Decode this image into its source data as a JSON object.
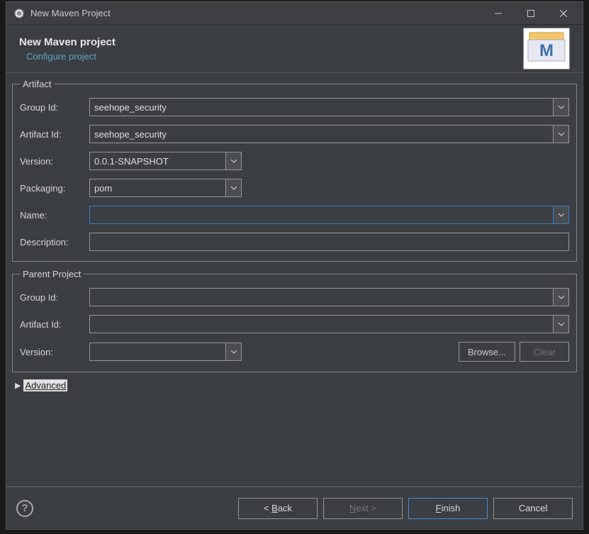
{
  "titlebar": {
    "title": "New Maven Project"
  },
  "banner": {
    "title": "New Maven project",
    "subtitle": "Configure project"
  },
  "artifact": {
    "legend": "Artifact",
    "group_id_label": "Group Id:",
    "group_id_value": "seehope_security",
    "artifact_id_label": "Artifact Id:",
    "artifact_id_value": "seehope_security",
    "version_label": "Version:",
    "version_value": "0.0.1-SNAPSHOT",
    "packaging_label": "Packaging:",
    "packaging_value": "pom",
    "name_label": "Name:",
    "name_value": "",
    "description_label": "Description:",
    "description_value": ""
  },
  "parent": {
    "legend": "Parent Project",
    "group_id_label": "Group Id:",
    "group_id_value": "",
    "artifact_id_label": "Artifact Id:",
    "artifact_id_value": "",
    "version_label": "Version:",
    "version_value": "",
    "browse_label": "Browse...",
    "clear_label": "Clear"
  },
  "advanced": {
    "label": "Advanced"
  },
  "footer": {
    "back_label": "< Back",
    "next_label": "Next >",
    "finish_label": "Finish",
    "cancel_label": "Cancel"
  }
}
